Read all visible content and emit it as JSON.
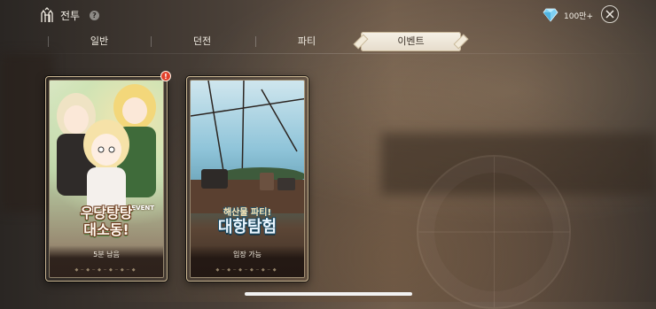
{
  "header": {
    "title": "전투",
    "help_symbol": "?",
    "currency_amount": "100만+",
    "battle_icon": "castle-gate-icon",
    "currency_icon": "diamond-gem-icon",
    "close_icon": "close-icon"
  },
  "tabs": [
    {
      "label": "일반",
      "active": false
    },
    {
      "label": "던전",
      "active": false
    },
    {
      "label": "파티",
      "active": false
    },
    {
      "label": "이벤트",
      "active": true
    }
  ],
  "cards": [
    {
      "event_tag": "EVENT",
      "title_line1": "우당탕탕",
      "title_line2": "대소동!",
      "status": "5분 남음",
      "badge": "!"
    },
    {
      "title_line1": "해산물 파티!",
      "title_line2": "대항탐험",
      "status": "입장 가능"
    }
  ],
  "colors": {
    "active_tab_bg": "#f3ecdf",
    "badge": "#e1402b",
    "card_border": "#cbb793"
  }
}
